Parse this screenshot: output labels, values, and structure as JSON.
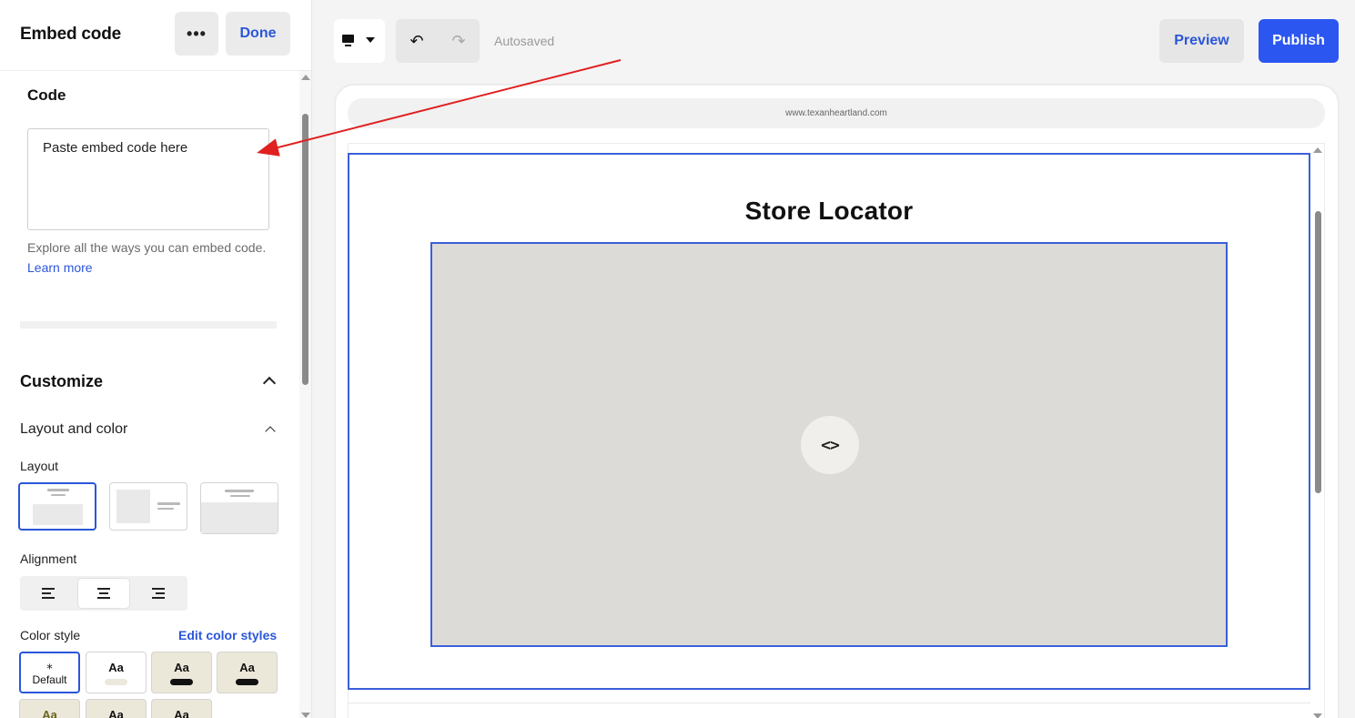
{
  "panel": {
    "title": "Embed code",
    "more_label": "•••",
    "done_label": "Done",
    "code": {
      "heading": "Code",
      "placeholder": "Paste embed code here",
      "value": "",
      "hint": "Explore all the ways you can embed code.",
      "learn_more": "Learn more"
    },
    "customize": {
      "heading": "Customize",
      "layout_and_color": "Layout and color",
      "layout_label": "Layout",
      "layout_options": [
        "stacked",
        "side-by-side",
        "banner"
      ],
      "layout_selected": "stacked",
      "alignment_label": "Alignment",
      "alignment_options": [
        "left",
        "center",
        "right"
      ],
      "alignment_selected": "center",
      "color_style_label": "Color style",
      "edit_color_styles": "Edit color styles",
      "swatches": [
        {
          "label": "Default",
          "icon": "magic-wand-icon",
          "bg": "#ffffff",
          "selected": true
        },
        {
          "label": "Aa",
          "bg": "#ffffff",
          "pill": "#ece8dc"
        },
        {
          "label": "Aa",
          "bg": "#ebe8d9",
          "pill": "#111111"
        },
        {
          "label": "Aa",
          "bg": "#ebe8d9",
          "pill": "#111111"
        },
        {
          "label": "Aa",
          "bg": "#ebe8d9"
        },
        {
          "label": "Aa",
          "bg": "#ebe8d9"
        },
        {
          "label": "Aa",
          "bg": "#ebe8d9"
        }
      ]
    }
  },
  "toolbar": {
    "device": "desktop-icon",
    "undo_icon": "undo-icon",
    "redo_icon": "redo-icon",
    "autosaved": "Autosaved",
    "preview": "Preview",
    "publish": "Publish"
  },
  "preview": {
    "url": "www.texanheartland.com",
    "section_title": "Store Locator",
    "embed_icon": "code-brackets-icon",
    "embed_glyph": "<>"
  },
  "colors": {
    "accent": "#2b56d9",
    "publish_bg": "#2b56f0",
    "selection_outline": "#3a5fd9",
    "embed_placeholder_bg": "#dcdbd7",
    "annotation_arrow": "#e02020"
  }
}
